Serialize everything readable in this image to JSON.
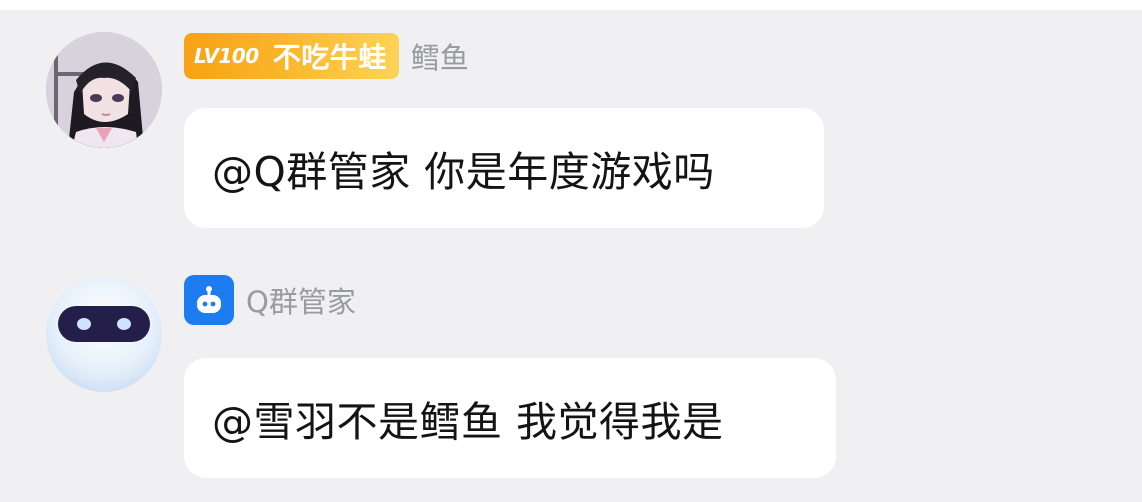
{
  "messages": [
    {
      "sender": "鳕鱼",
      "level": "LV100",
      "title": "不吃牛蛙",
      "avatar": "anime-girl-avatar",
      "text": "@Q群管家 你是年度游戏吗"
    },
    {
      "sender": "Q群管家",
      "avatar": "robot-avatar",
      "sender_icon": "robot-icon",
      "text": "@雪羽不是鳕鱼 我觉得我是"
    }
  ],
  "colors": {
    "background": "#f0f0f2",
    "bubble": "#ffffff",
    "badge_start": "#f7a214",
    "badge_end": "#ffd357",
    "bot_blue": "#1d7df0",
    "name_gray": "#9a9aa3"
  }
}
